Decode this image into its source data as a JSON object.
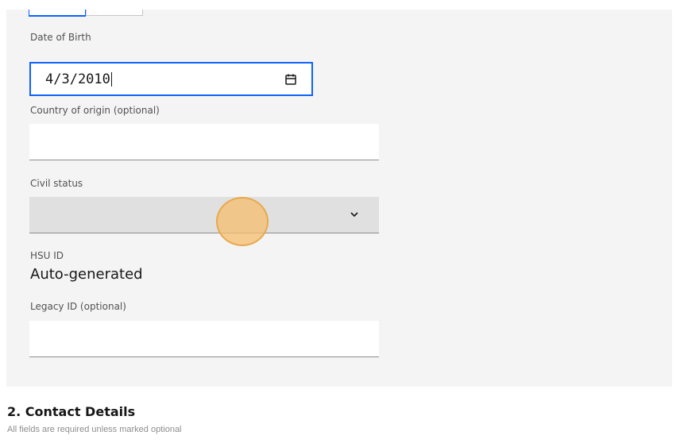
{
  "form": {
    "date_of_birth": {
      "label": "Date of Birth",
      "value": "4/3/2010",
      "icon": "calendar-icon"
    },
    "country_of_origin": {
      "label": "Country of origin (optional)",
      "value": ""
    },
    "civil_status": {
      "label": "Civil status",
      "value": "",
      "icon": "chevron-down-icon"
    },
    "hsu_id": {
      "label": "HSU ID",
      "value": "Auto-generated"
    },
    "legacy_id": {
      "label": "Legacy ID (optional)",
      "value": ""
    }
  },
  "contact_section": {
    "title": "2. Contact Details",
    "subtitle": "All fields are required unless marked optional"
  },
  "colors": {
    "focus": "#0f62fe",
    "panel": "#f4f4f4",
    "click_marker": "#f5be6e"
  }
}
